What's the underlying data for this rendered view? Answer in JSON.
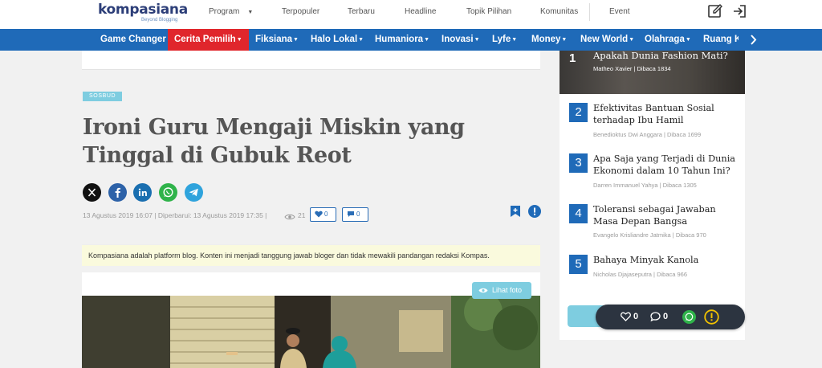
{
  "header": {
    "logo_text": "kompasiana",
    "logo_tagline": "Beyond Blogging",
    "nav": [
      {
        "label": "Program"
      },
      {
        "label": "Terpopuler"
      },
      {
        "label": "Terbaru"
      },
      {
        "label": "Headline"
      },
      {
        "label": "Topik Pilihan"
      },
      {
        "label": "Komunitas"
      },
      {
        "label": "Event"
      }
    ]
  },
  "categories": [
    {
      "label": "Game Changer"
    },
    {
      "label": "Cerita Pemilih"
    },
    {
      "label": "Fiksiana"
    },
    {
      "label": "Halo Lokal"
    },
    {
      "label": "Humaniora"
    },
    {
      "label": "Inovasi"
    },
    {
      "label": "Lyfe"
    },
    {
      "label": "Money"
    },
    {
      "label": "New World"
    },
    {
      "label": "Olahraga"
    },
    {
      "label": "Ruang K"
    }
  ],
  "article": {
    "tag": "SOSBUD",
    "title": "Ironi Guru Mengaji Miskin yang Tinggal di Gubuk Reot",
    "meta": "13 Agustus 2019   16:07  |   Diperbarui: 13 Agustus 2019   17:35  |",
    "views": "21",
    "likes": "0",
    "comments": "0",
    "disclaimer": "Kompasiana adalah platform blog. Konten ini menjadi tanggung jawab bloger dan tidak mewakili pandangan redaksi Kompas.",
    "photo_button": "Lihat foto"
  },
  "sidebar": {
    "items": [
      {
        "rank": "1",
        "title": "Apakah Dunia Fashion Mati?",
        "author": "Matheo Xavier",
        "reads": "Dibaca 1834"
      },
      {
        "rank": "2",
        "title": "Efektivitas Bantuan Sosial terhadap Ibu Hamil",
        "author": "Benedioktus Dwi Anggara",
        "reads": "Dibaca 1699"
      },
      {
        "rank": "3",
        "title": "Apa Saja yang Terjadi di Dunia Ekonomi dalam 10 Tahun Ini?",
        "author": "Darren Immanuel Yahya",
        "reads": "Dibaca 1305"
      },
      {
        "rank": "4",
        "title": "Toleransi sebagai Jawaban Masa Depan Bangsa",
        "author": "Evangelo Krisliandre Jatmika",
        "reads": "Dibaca 970"
      },
      {
        "rank": "5",
        "title": "Bahaya Minyak Kanola",
        "author": "Nicholas Djajaseputra",
        "reads": "Dibaca 966"
      }
    ]
  },
  "floating": {
    "likes": "0",
    "comments": "0"
  },
  "colors": {
    "brand_blue": "#1f6ab8",
    "active_red": "#e0262c",
    "tag_cyan": "#7ecde0",
    "float_dark": "#2c3440"
  }
}
